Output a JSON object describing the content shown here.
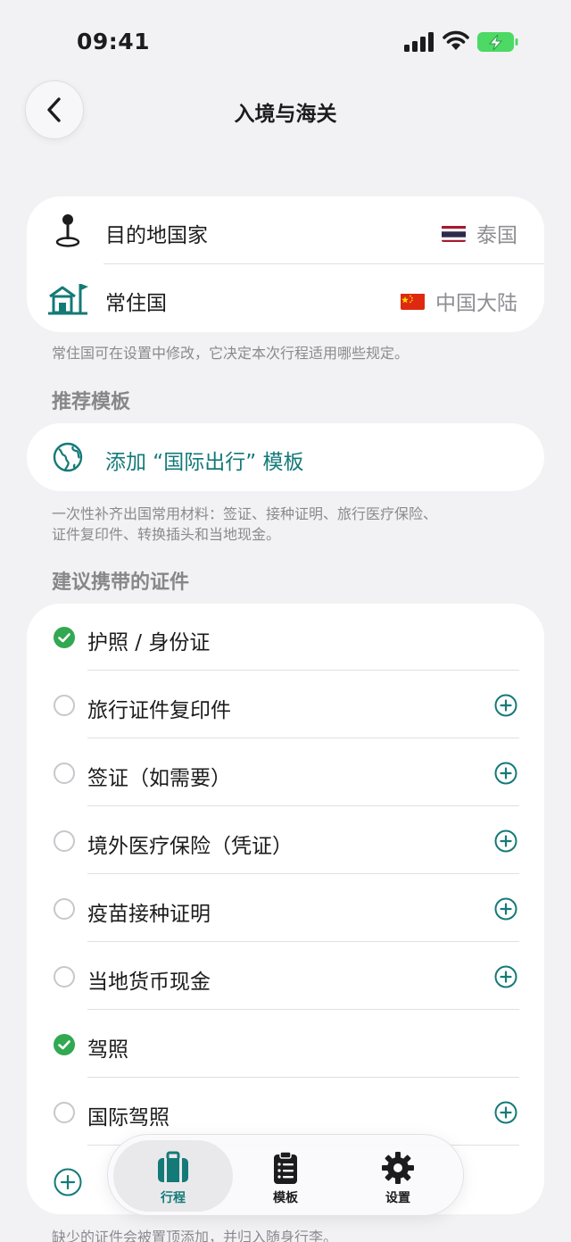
{
  "status_bar": {
    "time": "09:41"
  },
  "nav": {
    "title": "入境与海关"
  },
  "location": {
    "destination": {
      "label": "目的地国家",
      "value": "泰国",
      "icon": "map-pin-icon",
      "flag": "thailand-flag"
    },
    "residence": {
      "label": "常住国",
      "value": "中国大陆",
      "icon": "house-flag-icon",
      "flag": "china-flag"
    }
  },
  "residence_note": "常住国可在设置中修改，它决定本次行程适用哪些规定。",
  "recommended": {
    "title": "推荐模板",
    "template_label": "添加 “国际出行” 模板",
    "template_icon": "globe-icon",
    "note_line1": "一次性补齐出国常用材料：签证、接种证明、旅行医疗保险、",
    "note_line2": "证件复印件、转换插头和当地现金。"
  },
  "documents": {
    "title": "建议携带的证件",
    "items": [
      {
        "label": "护照 / 身份证",
        "checked": true
      },
      {
        "label": "旅行证件复印件",
        "checked": false
      },
      {
        "label": "签证（如需要）",
        "checked": false
      },
      {
        "label": "境外医疗保险（凭证）",
        "checked": false
      },
      {
        "label": "疫苗接种证明",
        "checked": false
      },
      {
        "label": "当地货币现金",
        "checked": false
      },
      {
        "label": "驾照",
        "checked": true
      },
      {
        "label": "国际驾照",
        "checked": false
      }
    ],
    "footer_note": "缺少的证件会被置顶添加，并归入随身行李。"
  },
  "tabbar": {
    "items": [
      {
        "label": "行程",
        "icon": "suitcase-icon",
        "active": true
      },
      {
        "label": "模板",
        "icon": "clipboard-list-icon",
        "active": false
      },
      {
        "label": "设置",
        "icon": "gear-icon",
        "active": false
      }
    ]
  },
  "colors": {
    "accent": "#147a78",
    "check_green": "#32a852",
    "background": "#f2f2f4"
  }
}
